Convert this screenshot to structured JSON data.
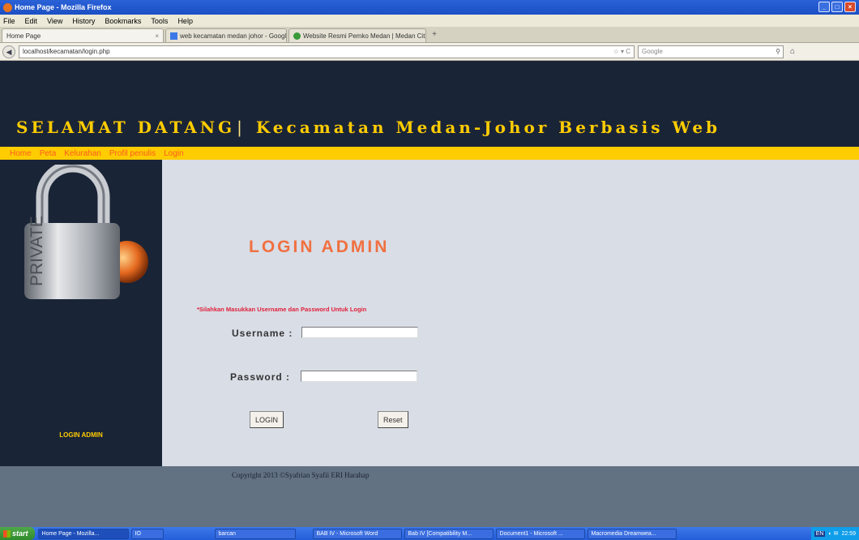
{
  "window": {
    "title": "Home Page - Mozilla Firefox"
  },
  "menubar": [
    "File",
    "Edit",
    "View",
    "History",
    "Bookmarks",
    "Tools",
    "Help"
  ],
  "tabs": [
    {
      "label": "Home Page",
      "active": true
    },
    {
      "label": "web kecamatan medan johor - Google Se...",
      "active": false
    },
    {
      "label": "Website Resmi Pemko Medan | Medan Cit...",
      "active": false
    }
  ],
  "navbar": {
    "url": "localhost/kecamatan/login.php",
    "search_placeholder": "Google"
  },
  "site": {
    "title_left": "SELAMAT DATANG",
    "title_sep": "|",
    "title_right": "Kecamatan Medan-Johor Berbasis Web",
    "nav": [
      "Home",
      "Peta",
      "Kelurahan",
      "Profil penulis",
      "Login"
    ],
    "sidebar_label": "LOGIN ADMIN",
    "lock_text": "PRIVATE"
  },
  "login": {
    "title": "LOGIN ADMIN",
    "note": "*Silahkan Masukkan Username dan Password Untuk Login",
    "username_label": "Username :",
    "username_value": "",
    "password_label": "Password :",
    "password_value": "",
    "login_button": "LOGIN",
    "reset_button": "Reset"
  },
  "footer": {
    "copyright": "Copyright 2013 ©Syafrian Syafii ERI Harahap"
  },
  "taskbar": {
    "start": "start",
    "tasks": [
      {
        "label": "Home Page - Mozilla...",
        "active": true
      },
      {
        "label": "IO",
        "active": false
      },
      {
        "label": "barcan",
        "active": false
      },
      {
        "label": "BAB IV - Microsoft Word",
        "active": false
      },
      {
        "label": "Bab IV [Compatibility M...",
        "active": false
      },
      {
        "label": "Document1 - Microsoft ...",
        "active": false
      },
      {
        "label": "Macromedia Dreamwea...",
        "active": false
      }
    ],
    "lang": "EN",
    "clock": "22:59"
  }
}
